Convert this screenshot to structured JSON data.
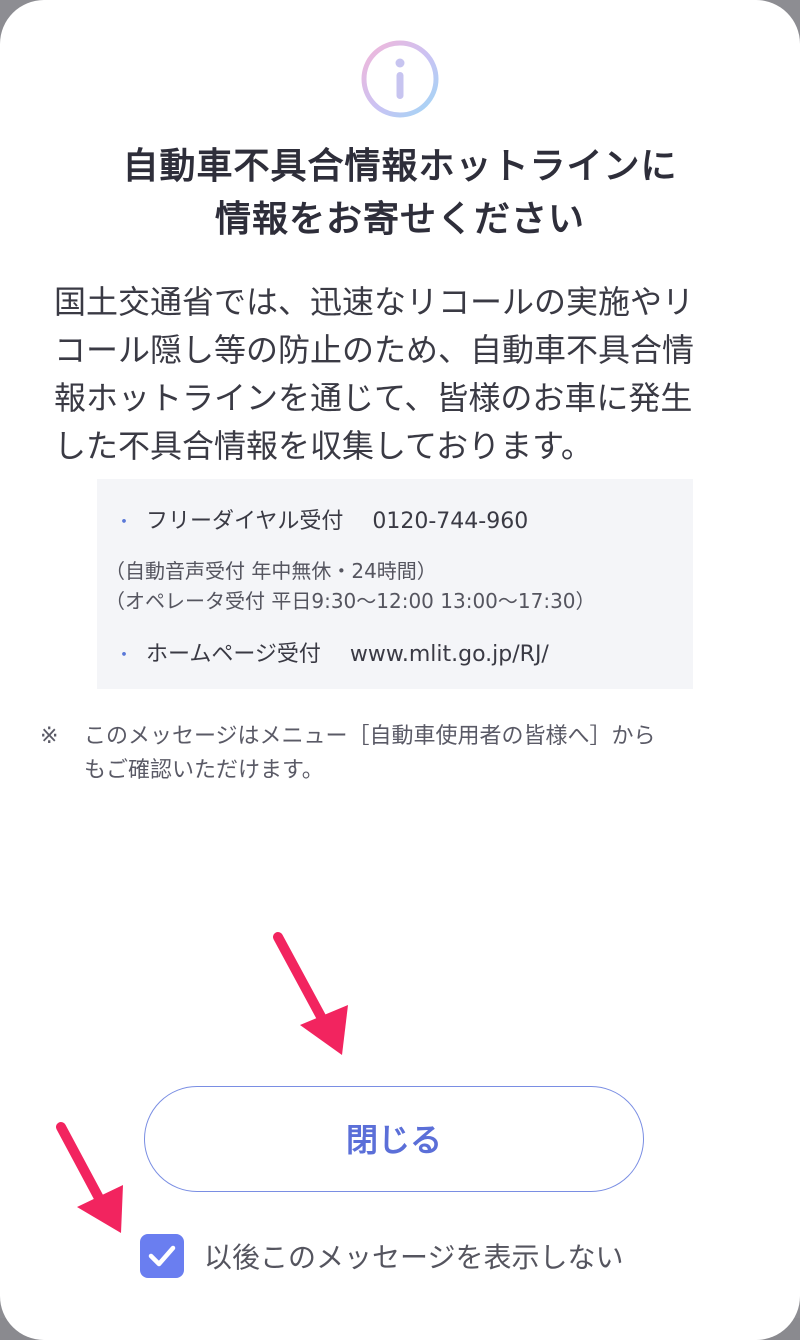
{
  "dialog": {
    "icon": "info-icon",
    "title_line1": "自動車不具合情報ホットラインに",
    "title_line2": "情報をお寄せください",
    "body_lines": [
      "国土交通省では、迅速なリコールの実施やリ",
      "コール隠し等の防止のため、自動車不具合情",
      "報ホットラインを通じて、皆様のお車に発生",
      "した不具合情報を収集しております。"
    ],
    "contacts": {
      "bullet": "・",
      "phone_label": "フリーダイヤル受付",
      "phone_value": "0120-744-960",
      "phone_note1": "（自動音声受付 年中無休・24時間）",
      "phone_note2": "（オペレータ受付 平日9:30～12:00 13:00～17:30）",
      "web_label": "ホームページ受付",
      "web_value": "www.mlit.go.jp/RJ/"
    },
    "footnote_mark": "※",
    "footnote_line1": "このメッセージはメニュー［自動車使用者の皆様へ］から",
    "footnote_line2": "もご確認いただけます。",
    "close_label": "閉じる",
    "dont_show_label": "以後このメッセージを表示しない",
    "dont_show_checked": true
  },
  "colors": {
    "accent": "#6a7ef0",
    "arrow": "#f2245f",
    "box_bg": "#f4f5f8"
  }
}
